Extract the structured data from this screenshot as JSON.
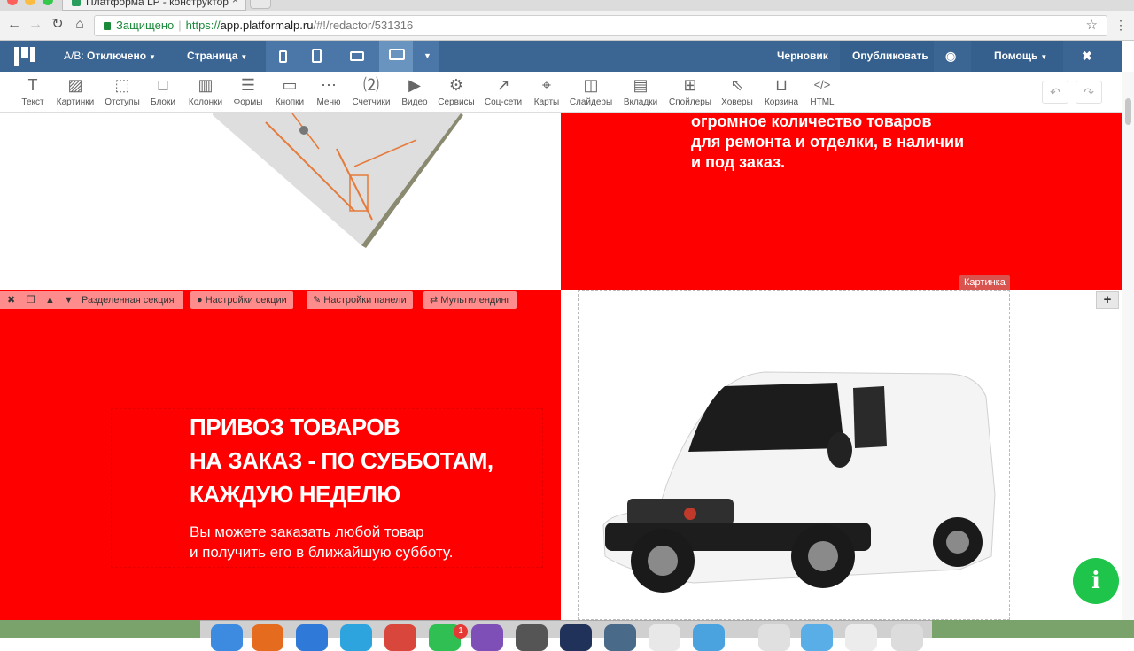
{
  "browser": {
    "tab_title": "Платформа LP - конструктор",
    "secure_label": "Защищено",
    "url_scheme": "https://",
    "url_host": "app.platformalp.ru",
    "url_path": "/#!/redactor/531316"
  },
  "topbar": {
    "ab_label": "А/В:",
    "ab_value": "Отключено",
    "page_label": "Страница",
    "draft_label": "Черновик",
    "publish_label": "Опубликовать",
    "help_label": "Помощь",
    "close_glyph": "✖",
    "accent": "#3b6593"
  },
  "tools": [
    {
      "label": "Текст",
      "icon": "text-icon"
    },
    {
      "label": "Картинки",
      "icon": "image-icon"
    },
    {
      "label": "Отступы",
      "icon": "spacing-icon"
    },
    {
      "label": "Блоки",
      "icon": "blocks-icon"
    },
    {
      "label": "Колонки",
      "icon": "columns-icon"
    },
    {
      "label": "Формы",
      "icon": "forms-icon"
    },
    {
      "label": "Кнопки",
      "icon": "buttons-icon"
    },
    {
      "label": "Меню",
      "icon": "menu-icon"
    },
    {
      "label": "Счетчики",
      "icon": "counters-icon"
    },
    {
      "label": "Видео",
      "icon": "video-icon"
    },
    {
      "label": "Сервисы",
      "icon": "services-icon"
    },
    {
      "label": "Соц-сети",
      "icon": "share-icon"
    },
    {
      "label": "Карты",
      "icon": "map-pin-icon"
    },
    {
      "label": "Слайдеры",
      "icon": "slider-icon"
    },
    {
      "label": "Вкладки",
      "icon": "tabs-icon"
    },
    {
      "label": "Спойлеры",
      "icon": "spoiler-icon"
    },
    {
      "label": "Ховеры",
      "icon": "hover-icon"
    },
    {
      "label": "Корзина",
      "icon": "cart-icon"
    },
    {
      "label": "HTML",
      "icon": "code-icon"
    }
  ],
  "section1": {
    "lines": [
      "огромное количество товаров",
      "для ремонта и отделки, в наличии",
      "и под заказ."
    ]
  },
  "panel": {
    "section_name": "Разделенная секция",
    "section_settings": "Настройки секции",
    "panel_settings": "Настройки панели",
    "multilanding": "Мультилендинг"
  },
  "section2": {
    "headline": [
      "ПРИВОЗ ТОВАРОВ",
      "НА ЗАКАЗ - ПО СУББОТАМ,",
      "КАЖДУЮ НЕДЕЛЮ"
    ],
    "subtext": [
      "Вы можете заказать любой товар",
      "и получить его в ближайшую субботу."
    ],
    "image_label": "Картинка",
    "brand_red": "#ff0000"
  },
  "dock": {
    "badge": "1"
  }
}
